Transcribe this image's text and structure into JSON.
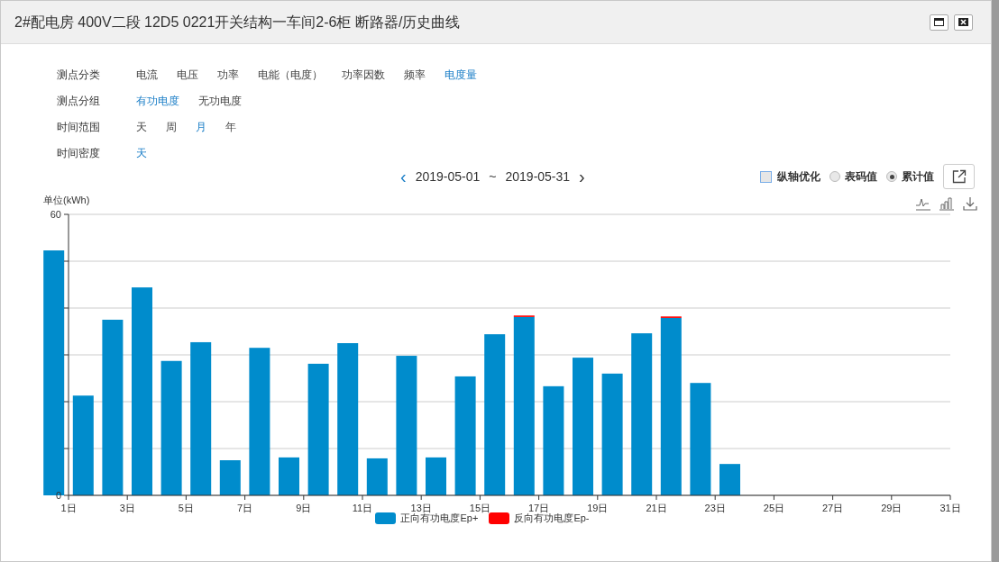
{
  "window": {
    "title": "2#配电房 400V二段 12D5 0221开关结构一车间2-6柜 断路器/历史曲线"
  },
  "filters": [
    {
      "label": "测点分类",
      "options": [
        {
          "label": "电流",
          "selected": false
        },
        {
          "label": "电压",
          "selected": false
        },
        {
          "label": "功率",
          "selected": false
        },
        {
          "label": "电能（电度）",
          "selected": false
        },
        {
          "label": "功率因数",
          "selected": false
        },
        {
          "label": "频率",
          "selected": false
        },
        {
          "label": "电度量",
          "selected": true
        }
      ]
    },
    {
      "label": "测点分组",
      "options": [
        {
          "label": "有功电度",
          "selected": true
        },
        {
          "label": "无功电度",
          "selected": false
        }
      ]
    },
    {
      "label": "时间范围",
      "options": [
        {
          "label": "天",
          "selected": false
        },
        {
          "label": "周",
          "selected": false
        },
        {
          "label": "月",
          "selected": true
        },
        {
          "label": "年",
          "selected": false
        }
      ]
    },
    {
      "label": "时间密度",
      "options": [
        {
          "label": "天",
          "selected": true
        }
      ]
    }
  ],
  "date_range": {
    "prev": "‹",
    "start": "2019-05-01",
    "separator": "~",
    "end": "2019-05-31",
    "next": "›"
  },
  "options": {
    "axis_optimize": {
      "label": "纵轴优化",
      "checked": false
    },
    "mode": [
      {
        "label": "表码值",
        "selected": false
      },
      {
        "label": "累计值",
        "selected": true
      }
    ]
  },
  "chart": {
    "unit": "单位(kWh)",
    "chart_data": {
      "type": "bar",
      "stacked": true,
      "ylim": [
        0,
        60
      ],
      "yticks": [
        0,
        60
      ],
      "xlim": [
        0,
        31
      ],
      "x": [
        0.5,
        1.5,
        2.5,
        3.5,
        4.5,
        5.5,
        6.5,
        7.5,
        8.5,
        9.5,
        10.5,
        11.5,
        12.5,
        13.5,
        14.5,
        15.5,
        16.5,
        17.5,
        18.5,
        19.5,
        20.5,
        21.5,
        22.5,
        23.5
      ],
      "xticks": [
        {
          "value": 1,
          "label": "1日"
        },
        {
          "value": 3,
          "label": "3日"
        },
        {
          "value": 5,
          "label": "5日"
        },
        {
          "value": 7,
          "label": "7日"
        },
        {
          "value": 9,
          "label": "9日"
        },
        {
          "value": 11,
          "label": "11日"
        },
        {
          "value": 13,
          "label": "13日"
        },
        {
          "value": 15,
          "label": "15日"
        },
        {
          "value": 17,
          "label": "17日"
        },
        {
          "value": 19,
          "label": "19日"
        },
        {
          "value": 21,
          "label": "21日"
        },
        {
          "value": 23,
          "label": "23日"
        },
        {
          "value": 25,
          "label": "25日"
        },
        {
          "value": 27,
          "label": "27日"
        },
        {
          "value": 29,
          "label": "29日"
        },
        {
          "value": 31,
          "label": "31日"
        }
      ],
      "series": [
        {
          "name": "正向有功电度Ep+",
          "color": "#008ccc",
          "values": [
            52.3,
            21.3,
            37.5,
            44.4,
            28.7,
            32.7,
            7.5,
            31.5,
            8.1,
            28.1,
            32.5,
            7.9,
            29.8,
            8.1,
            25.4,
            34.4,
            38.1,
            23.3,
            29.4,
            26.0,
            34.6,
            37.9,
            24.0,
            6.7
          ]
        },
        {
          "name": "反向有功电度Ep-",
          "color": "#ff0000",
          "values": [
            0,
            0,
            0,
            0,
            0,
            0,
            0,
            0,
            0,
            0,
            0,
            0,
            0,
            0,
            0,
            0,
            0.3,
            0,
            0,
            0,
            0,
            0.3,
            0,
            0
          ]
        }
      ]
    }
  }
}
